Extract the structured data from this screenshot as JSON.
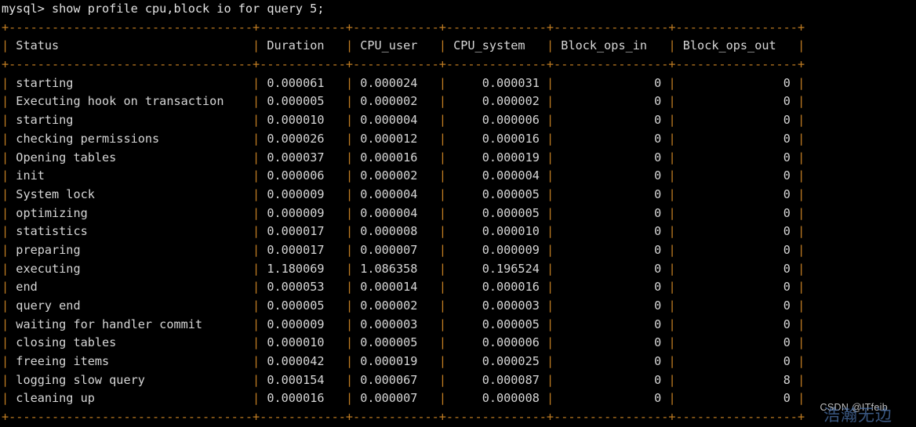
{
  "terminal": {
    "prompt": "mysql> show profile cpu,block io for query 5;",
    "colors": {
      "background": "#000000",
      "text": "#d6d6d6",
      "border": "#c17d22",
      "watermark": "#cfcfcf"
    }
  },
  "table": {
    "columns": [
      {
        "key": "status",
        "label": "Status",
        "width": 32,
        "align": "left"
      },
      {
        "key": "duration",
        "label": "Duration",
        "width": 10,
        "align": "left"
      },
      {
        "key": "cpu_user",
        "label": "CPU_user",
        "width": 10,
        "align": "left"
      },
      {
        "key": "cpu_system",
        "label": "CPU_system",
        "width": 12,
        "align": "right"
      },
      {
        "key": "block_ops_in",
        "label": "Block_ops_in",
        "width": 14,
        "align": "right"
      },
      {
        "key": "block_ops_out",
        "label": "Block_ops_out",
        "width": 15,
        "align": "right"
      }
    ],
    "rows": [
      {
        "status": "starting",
        "duration": "0.000061",
        "cpu_user": "0.000024",
        "cpu_system": "0.000031",
        "block_ops_in": "0",
        "block_ops_out": "0"
      },
      {
        "status": "Executing hook on transaction",
        "duration": "0.000005",
        "cpu_user": "0.000002",
        "cpu_system": "0.000002",
        "block_ops_in": "0",
        "block_ops_out": "0"
      },
      {
        "status": "starting",
        "duration": "0.000010",
        "cpu_user": "0.000004",
        "cpu_system": "0.000006",
        "block_ops_in": "0",
        "block_ops_out": "0"
      },
      {
        "status": "checking permissions",
        "duration": "0.000026",
        "cpu_user": "0.000012",
        "cpu_system": "0.000016",
        "block_ops_in": "0",
        "block_ops_out": "0"
      },
      {
        "status": "Opening tables",
        "duration": "0.000037",
        "cpu_user": "0.000016",
        "cpu_system": "0.000019",
        "block_ops_in": "0",
        "block_ops_out": "0"
      },
      {
        "status": "init",
        "duration": "0.000006",
        "cpu_user": "0.000002",
        "cpu_system": "0.000004",
        "block_ops_in": "0",
        "block_ops_out": "0"
      },
      {
        "status": "System lock",
        "duration": "0.000009",
        "cpu_user": "0.000004",
        "cpu_system": "0.000005",
        "block_ops_in": "0",
        "block_ops_out": "0"
      },
      {
        "status": "optimizing",
        "duration": "0.000009",
        "cpu_user": "0.000004",
        "cpu_system": "0.000005",
        "block_ops_in": "0",
        "block_ops_out": "0"
      },
      {
        "status": "statistics",
        "duration": "0.000017",
        "cpu_user": "0.000008",
        "cpu_system": "0.000010",
        "block_ops_in": "0",
        "block_ops_out": "0"
      },
      {
        "status": "preparing",
        "duration": "0.000017",
        "cpu_user": "0.000007",
        "cpu_system": "0.000009",
        "block_ops_in": "0",
        "block_ops_out": "0"
      },
      {
        "status": "executing",
        "duration": "1.180069",
        "cpu_user": "1.086358",
        "cpu_system": "0.196524",
        "block_ops_in": "0",
        "block_ops_out": "0"
      },
      {
        "status": "end",
        "duration": "0.000053",
        "cpu_user": "0.000014",
        "cpu_system": "0.000016",
        "block_ops_in": "0",
        "block_ops_out": "0"
      },
      {
        "status": "query end",
        "duration": "0.000005",
        "cpu_user": "0.000002",
        "cpu_system": "0.000003",
        "block_ops_in": "0",
        "block_ops_out": "0"
      },
      {
        "status": "waiting for handler commit",
        "duration": "0.000009",
        "cpu_user": "0.000003",
        "cpu_system": "0.000005",
        "block_ops_in": "0",
        "block_ops_out": "0"
      },
      {
        "status": "closing tables",
        "duration": "0.000010",
        "cpu_user": "0.000005",
        "cpu_system": "0.000006",
        "block_ops_in": "0",
        "block_ops_out": "0"
      },
      {
        "status": "freeing items",
        "duration": "0.000042",
        "cpu_user": "0.000019",
        "cpu_system": "0.000025",
        "block_ops_in": "0",
        "block_ops_out": "0"
      },
      {
        "status": "logging slow query",
        "duration": "0.000154",
        "cpu_user": "0.000067",
        "cpu_system": "0.000087",
        "block_ops_in": "0",
        "block_ops_out": "8"
      },
      {
        "status": "cleaning up",
        "duration": "0.000016",
        "cpu_user": "0.000007",
        "cpu_system": "0.000008",
        "block_ops_in": "0",
        "block_ops_out": "0"
      }
    ]
  },
  "watermark": {
    "text": "CSDN @ITfeib",
    "sub_text": "浩瀚无边"
  }
}
